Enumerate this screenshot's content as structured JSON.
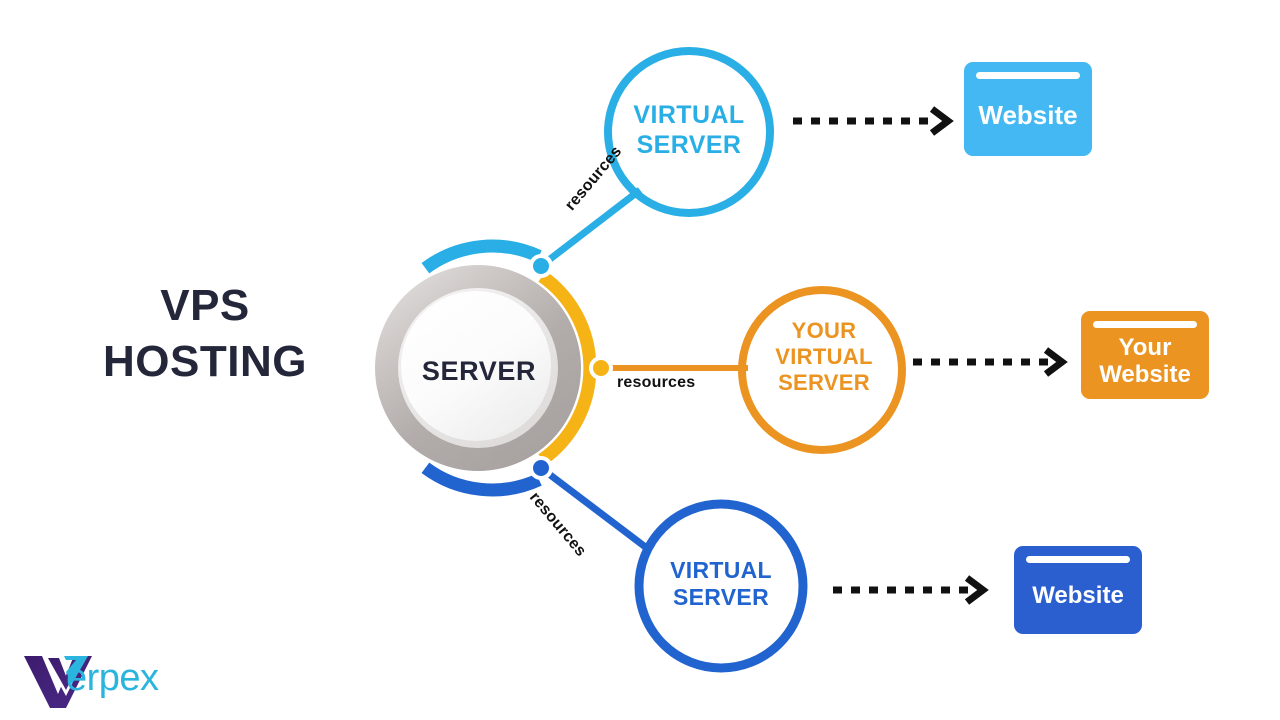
{
  "page": {
    "title": "VPS\nHOSTING",
    "background_color": "#ffffff"
  },
  "colors": {
    "cyan": "#29aee6",
    "cyan_card": "#43b8f2",
    "orange": "#eb9421",
    "blue": "#2264cf",
    "blue_card": "#2b5fd0",
    "ring_gray": "#b5b0ae",
    "text_dark": "#24263a",
    "arrow_black": "#111111",
    "logo_mark": "#3c1b6e",
    "logo_text": "#2ab4de"
  },
  "server": {
    "label": "SERVER",
    "arcs": [
      {
        "name": "top-arc",
        "color": "#29aee6"
      },
      {
        "name": "middle-arc",
        "color": "#f5b315"
      },
      {
        "name": "bottom-arc",
        "color": "#2264cf"
      }
    ]
  },
  "branches": [
    {
      "id": "top",
      "connector_label": "resources",
      "virtual_server_label": "VIRTUAL\nSERVER",
      "virtual_server_color": "#29aee6",
      "website_label": "Website",
      "website_color": "#43b8f2"
    },
    {
      "id": "middle",
      "connector_label": "resources",
      "virtual_server_label": "YOUR\nVIRTUAL\nSERVER",
      "virtual_server_color": "#eb9421",
      "website_label": "Your\nWebsite",
      "website_color": "#eb9421"
    },
    {
      "id": "bottom",
      "connector_label": "resources",
      "virtual_server_label": "VIRTUAL\nSERVER",
      "virtual_server_color": "#2264cf",
      "website_label": "Website",
      "website_color": "#2b5fd0"
    }
  ],
  "logo": {
    "mark": "verpex-v-mark",
    "wordmark": "erpex"
  }
}
